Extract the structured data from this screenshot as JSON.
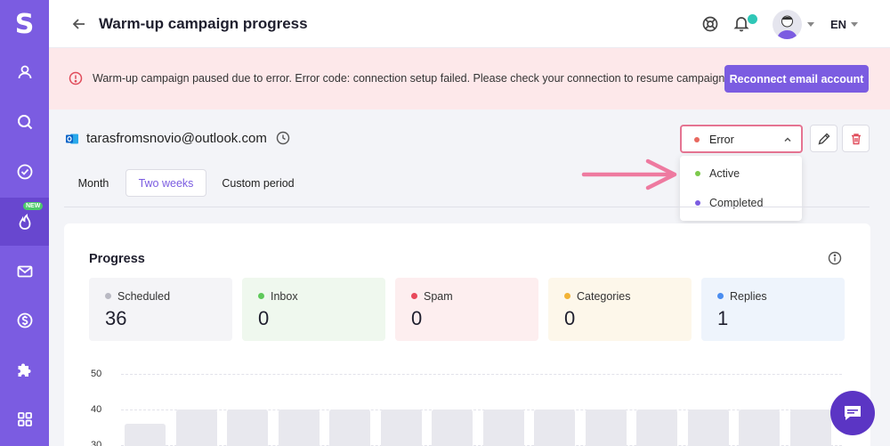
{
  "app": {
    "logo": "S"
  },
  "sidebar": {
    "items": [
      {
        "name": "contacts",
        "icon": "user-icon"
      },
      {
        "name": "search",
        "icon": "search-icon"
      },
      {
        "name": "tasks",
        "icon": "check-circle-icon"
      },
      {
        "name": "warmup",
        "icon": "flame-icon",
        "badge": "NEW",
        "active": true
      },
      {
        "name": "email",
        "icon": "mail-icon"
      },
      {
        "name": "billing",
        "icon": "dollar-icon"
      },
      {
        "name": "integrations",
        "icon": "puzzle-icon"
      },
      {
        "name": "apps",
        "icon": "grid-icon"
      }
    ]
  },
  "header": {
    "title": "Warm-up campaign progress",
    "language": "EN"
  },
  "alert": {
    "message": "Warm-up campaign paused due to error. Error code: connection setup failed. Please check your connection to resume campaign.",
    "button_label": "Reconnect email account"
  },
  "account": {
    "email": "tarasfromsnovio@outlook.com"
  },
  "status": {
    "selected": "Error",
    "selected_color": "#e8685f",
    "options": [
      {
        "label": "Active",
        "color": "#7cc94c"
      },
      {
        "label": "Completed",
        "color": "#7b5ce1"
      }
    ]
  },
  "periods": {
    "month": "Month",
    "two_weeks": "Two weeks",
    "custom": "Custom period",
    "selected": "Two weeks"
  },
  "progress": {
    "title": "Progress",
    "stats": [
      {
        "label": "Scheduled",
        "value": "36",
        "dot": "#b9b9c3",
        "bg": "#f4f4f7"
      },
      {
        "label": "Inbox",
        "value": "0",
        "dot": "#5ec95a",
        "bg": "#eff8ee"
      },
      {
        "label": "Spam",
        "value": "0",
        "dot": "#e8495b",
        "bg": "#fdeeef"
      },
      {
        "label": "Categories",
        "value": "0",
        "dot": "#f2b335",
        "bg": "#fdf7ea"
      },
      {
        "label": "Replies",
        "value": "1",
        "dot": "#4a8df0",
        "bg": "#eef4fc"
      }
    ]
  },
  "chart_data": {
    "type": "bar",
    "y_ticks": [
      "50",
      "40",
      "30"
    ],
    "values": [
      36,
      40,
      40,
      40,
      40,
      40,
      40,
      40,
      40,
      40,
      40,
      40,
      40,
      40
    ]
  },
  "colors": {
    "accent": "#7b5ce1",
    "alert_bg": "#fde8ea",
    "error_border": "#e57492"
  }
}
